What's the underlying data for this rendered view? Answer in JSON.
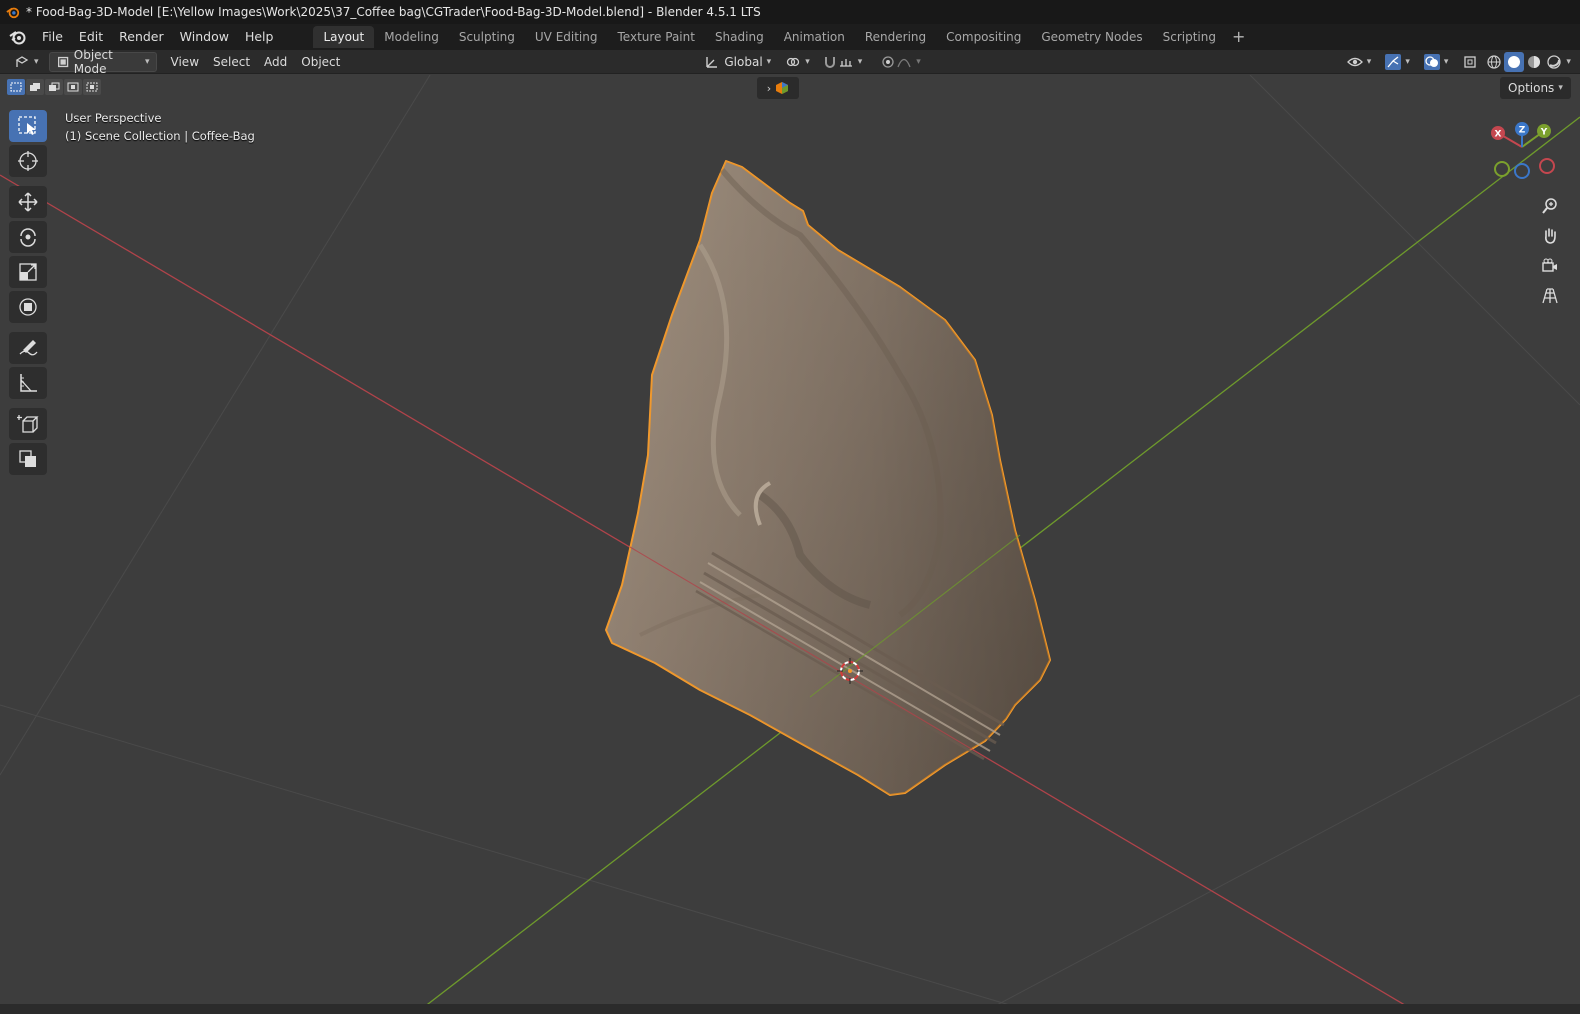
{
  "window": {
    "title": "* Food-Bag-3D-Model [E:\\Yellow Images\\Work\\2025\\37_Coffee bag\\CGTrader\\Food-Bag-3D-Model.blend] - Blender 4.5.1 LTS"
  },
  "menu": {
    "items": [
      "File",
      "Edit",
      "Render",
      "Window",
      "Help"
    ]
  },
  "workspaces": {
    "tabs": [
      "Layout",
      "Modeling",
      "Sculpting",
      "UV Editing",
      "Texture Paint",
      "Shading",
      "Animation",
      "Rendering",
      "Compositing",
      "Geometry Nodes",
      "Scripting"
    ],
    "active": "Layout"
  },
  "header": {
    "mode": "Object Mode",
    "menus": [
      "View",
      "Select",
      "Add",
      "Object"
    ],
    "transform_orientation": "Global"
  },
  "viewport": {
    "perspective": "User Perspective",
    "collection": "(1) Scene Collection | Coffee-Bag",
    "options_label": "Options"
  },
  "gizmo": {
    "x": "X",
    "y": "Y",
    "z": "Z"
  },
  "colors": {
    "accent": "#4772b3",
    "selection_outline": "#f29a2e",
    "axis_x": "#c4474f",
    "axis_y": "#7ba02d",
    "axis_z": "#3b77c9",
    "viewport_bg": "#3d3d3d",
    "bag_fill": "#8d7d6e"
  }
}
